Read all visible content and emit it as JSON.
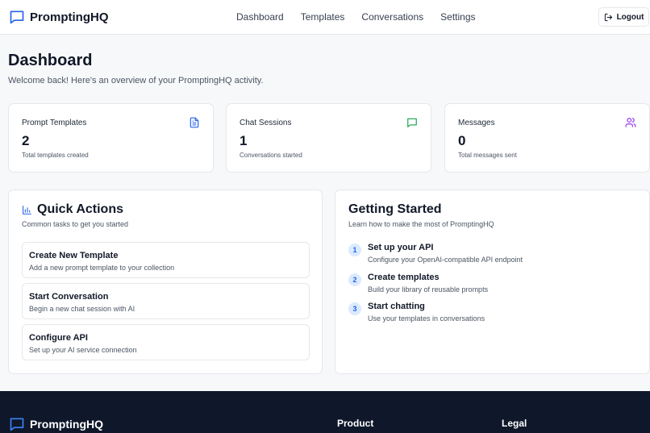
{
  "brand": {
    "name": "PromptingHQ",
    "accent": "#2563eb"
  },
  "nav": {
    "links": [
      "Dashboard",
      "Templates",
      "Conversations",
      "Settings"
    ],
    "logout_label": "Logout"
  },
  "page": {
    "title": "Dashboard",
    "subtitle": "Welcome back! Here's an overview of your PromptingHQ activity."
  },
  "stats": [
    {
      "label": "Prompt Templates",
      "value": "2",
      "desc": "Total templates created",
      "icon": "document-icon",
      "color": "#2563eb"
    },
    {
      "label": "Chat Sessions",
      "value": "1",
      "desc": "Conversations started",
      "icon": "chat-icon",
      "color": "#16a34a"
    },
    {
      "label": "Messages",
      "value": "0",
      "desc": "Total messages sent",
      "icon": "users-icon",
      "color": "#9333ea"
    }
  ],
  "quick_actions": {
    "title": "Quick Actions",
    "subtitle": "Common tasks to get you started",
    "icon": "bar-chart-icon",
    "items": [
      {
        "title": "Create New Template",
        "desc": "Add a new prompt template to your collection"
      },
      {
        "title": "Start Conversation",
        "desc": "Begin a new chat session with AI"
      },
      {
        "title": "Configure API",
        "desc": "Set up your AI service connection"
      }
    ]
  },
  "getting_started": {
    "title": "Getting Started",
    "subtitle": "Learn how to make the most of PromptingHQ",
    "steps": [
      {
        "num": "1",
        "title": "Set up your API",
        "desc": "Configure your OpenAI-compatible API endpoint"
      },
      {
        "num": "2",
        "title": "Create templates",
        "desc": "Build your library of reusable prompts"
      },
      {
        "num": "3",
        "title": "Start chatting",
        "desc": "Use your templates in conversations"
      }
    ]
  },
  "footer": {
    "brand": "PromptingHQ",
    "headings": [
      "Product",
      "Legal"
    ],
    "background": "#0f172a"
  }
}
